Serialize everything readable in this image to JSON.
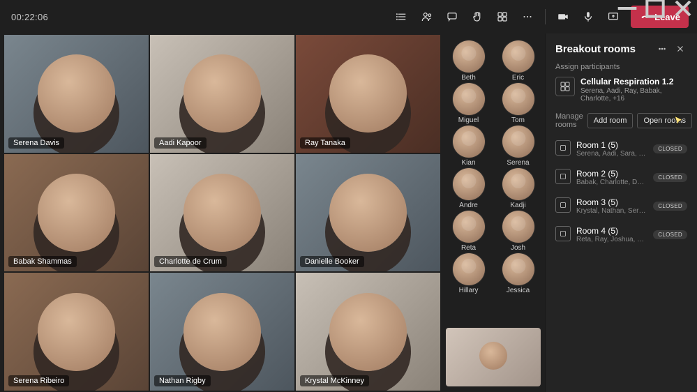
{
  "timer": "00:22:06",
  "leave_label": "Leave",
  "video_tiles": [
    {
      "name": "Serena Davis"
    },
    {
      "name": "Aadi Kapoor"
    },
    {
      "name": "Ray Tanaka"
    },
    {
      "name": "Babak Shammas"
    },
    {
      "name": "Charlotte de Crum"
    },
    {
      "name": "Danielle Booker"
    },
    {
      "name": "Serena Ribeiro"
    },
    {
      "name": "Nathan Rigby"
    },
    {
      "name": "Krystal McKinney"
    }
  ],
  "thumbnails": [
    {
      "name": "Beth"
    },
    {
      "name": "Eric"
    },
    {
      "name": "Miguel"
    },
    {
      "name": "Tom"
    },
    {
      "name": "Kian"
    },
    {
      "name": "Serena"
    },
    {
      "name": "Andre"
    },
    {
      "name": "Kadji"
    },
    {
      "name": "Reta"
    },
    {
      "name": "Josh"
    },
    {
      "name": "Hillary"
    },
    {
      "name": "Jessica"
    }
  ],
  "panel": {
    "title": "Breakout rooms",
    "assign_label": "Assign participants",
    "meeting": {
      "title": "Cellular Respiration 1.2",
      "subtitle": "Serena, Aadi, Ray, Babak, Charlotte, +16"
    },
    "manage_label": "Manage rooms",
    "add_room_label": "Add room",
    "open_rooms_label": "Open rooms",
    "rooms": [
      {
        "title": "Room 1 (5)",
        "subtitle": "Serena, Aadi, Sara, Tom, Eric",
        "status": "CLOSED"
      },
      {
        "title": "Room 2 (5)",
        "subtitle": "Babak, Charlotte, Danielle, Mig…",
        "status": "CLOSED"
      },
      {
        "title": "Room 3 (5)",
        "subtitle": "Krystal, Nathan, Serena, Andre…",
        "status": "CLOSED"
      },
      {
        "title": "Room 4 (5)",
        "subtitle": "Reta, Ray, Joshua, Darren, Hilla…",
        "status": "CLOSED"
      }
    ]
  }
}
